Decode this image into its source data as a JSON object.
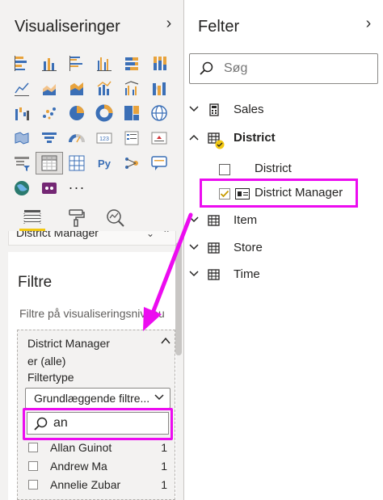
{
  "visualizations": {
    "title": "Visualiseringer",
    "collapse_icon": "chevron-right-icon",
    "more_label": "···"
  },
  "field_well": {
    "label": "District Manager"
  },
  "filters": {
    "title": "Filtre",
    "subtitle": "Filtre på visualiseringsniveau",
    "card": {
      "field": "District Manager",
      "state": "er (alle)",
      "type_label": "Filtertype",
      "type_value": "Grundlæggende filtre...",
      "search_value": "an",
      "items": [
        {
          "name": "Allan Guinot",
          "count": "1"
        },
        {
          "name": "Andrew Ma",
          "count": "1"
        },
        {
          "name": "Annelie Zubar",
          "count": "1"
        }
      ]
    }
  },
  "fields": {
    "title": "Felter",
    "search_placeholder": "Søg",
    "tables": [
      {
        "name": "Sales",
        "expanded": false
      },
      {
        "name": "District",
        "expanded": true
      },
      {
        "name": "Item",
        "expanded": false
      },
      {
        "name": "Store",
        "expanded": false
      },
      {
        "name": "Time",
        "expanded": false
      }
    ],
    "district_fields": [
      {
        "name": "District",
        "checked": false
      },
      {
        "name": "District Manager",
        "checked": true
      }
    ]
  },
  "colors": {
    "highlight": "#ec0cf0",
    "accent_yellow": "#f2c811",
    "panel_bg": "#f3f2f1"
  }
}
